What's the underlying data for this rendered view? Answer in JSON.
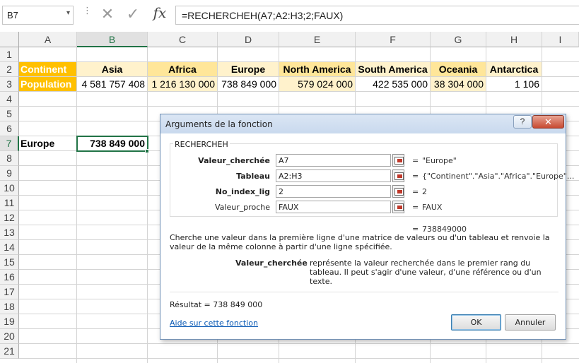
{
  "formula_bar": {
    "name_box": "B7",
    "name_box_arrow": "▾",
    "dots": "⋮",
    "cancel_glyph": "✕",
    "enter_glyph": "✓",
    "fx": "fx",
    "formula": "=RECHERCHEH(A7;A2:H3;2;FAUX)"
  },
  "columns": [
    "A",
    "B",
    "C",
    "D",
    "E",
    "F",
    "G",
    "H",
    "I"
  ],
  "rows": [
    "1",
    "2",
    "3",
    "4",
    "5",
    "6",
    "7",
    "8",
    "9",
    "10",
    "11",
    "12",
    "13",
    "14",
    "15",
    "16",
    "17",
    "18",
    "19",
    "20",
    "21"
  ],
  "selected_cell": "B7",
  "sheet": {
    "row2": [
      "Continent",
      "Asia",
      "Africa",
      "Europe",
      "North America",
      "South America",
      "Oceania",
      "Antarctica"
    ],
    "row3": [
      "Population",
      "4 581 757 408",
      "1 216 130 000",
      "738 849 000",
      "579 024 000",
      "422 535 000",
      "38 304 000",
      "1 106"
    ],
    "a7": "Europe",
    "b7": "738 849 000"
  },
  "colors": {
    "orange": "#ffc000",
    "light_orange": "#fff2cc",
    "medium_orange": "#ffe699",
    "excel_green": "#217346"
  },
  "dialog": {
    "title": "Arguments de la fonction",
    "help_button": "?",
    "close_button": "✕",
    "function_name": "RECHERCHEH",
    "args": [
      {
        "label": "Valeur_cherchée",
        "value": "A7",
        "result": "\"Europe\""
      },
      {
        "label": "Tableau",
        "value": "A2:H3",
        "result": "{\"Continent\".\"Asia\".\"Africa\".\"Europe\"..."
      },
      {
        "label": "No_index_lig",
        "value": "2",
        "result": "2"
      },
      {
        "label": "Valeur_proche",
        "value": "FAUX",
        "result": "FAUX"
      }
    ],
    "equals": "=",
    "inline_result": "738849000",
    "description": "Cherche une valeur dans la première ligne d'une matrice de valeurs ou d'un tableau et renvoie la valeur de la même colonne à partir d'une ligne spécifiée.",
    "arg_help_name": "Valeur_cherchée",
    "arg_help_desc": "représente la valeur recherchée dans le premier rang du tableau. Il peut s'agir d'une valeur, d'une référence ou d'un texte.",
    "result_label": "Résultat =   738 849 000",
    "help_link": "Aide sur cette fonction",
    "ok": "OK",
    "cancel": "Annuler"
  }
}
